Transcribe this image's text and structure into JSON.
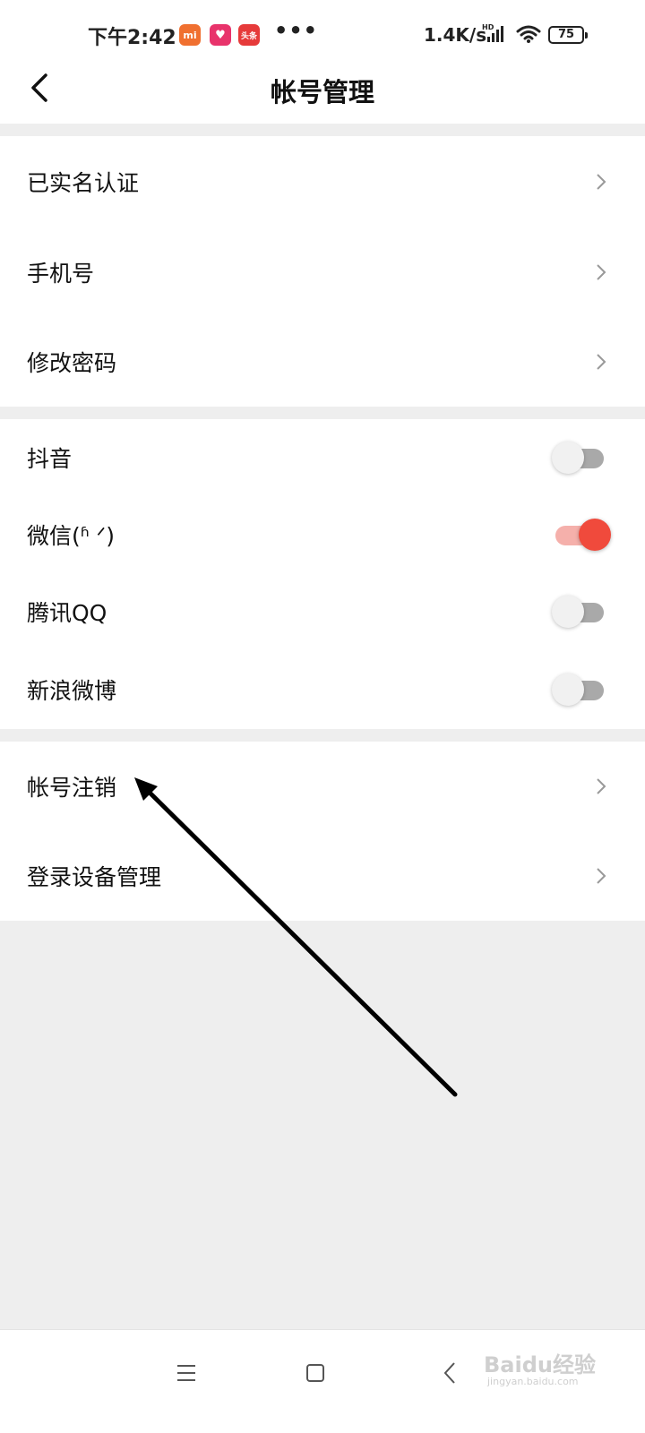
{
  "status_bar": {
    "time": "下午2:42",
    "app_badges": [
      "mi",
      "♥",
      "头条"
    ],
    "more": "•••",
    "net_speed": "1.4K/s",
    "battery": "75"
  },
  "header": {
    "title": "帐号管理"
  },
  "groups": [
    {
      "rows": [
        {
          "label": "已实名认证",
          "type": "link"
        },
        {
          "label": "手机号",
          "type": "link"
        },
        {
          "label": "修改密码",
          "type": "link"
        }
      ]
    },
    {
      "rows": [
        {
          "label": "抖音",
          "type": "toggle",
          "on": false
        },
        {
          "label": "微信(ʱ                    ᐟ)",
          "type": "toggle",
          "on": true
        },
        {
          "label": "腾讯QQ",
          "type": "toggle",
          "on": false
        },
        {
          "label": "新浪微博",
          "type": "toggle",
          "on": false
        }
      ]
    },
    {
      "rows": [
        {
          "label": "帐号注销",
          "type": "link"
        },
        {
          "label": "登录设备管理",
          "type": "link"
        }
      ]
    }
  ],
  "colors": {
    "accent": "#f04a3c",
    "background": "#eeeeee"
  },
  "watermark": {
    "text": "Baidu经验",
    "sub": "jingyan.baidu.com"
  },
  "icons": [
    "back-icon",
    "chevron-right-icon",
    "menu-icon",
    "home-icon",
    "nav-back-icon",
    "signal-icon",
    "wifi-icon"
  ]
}
